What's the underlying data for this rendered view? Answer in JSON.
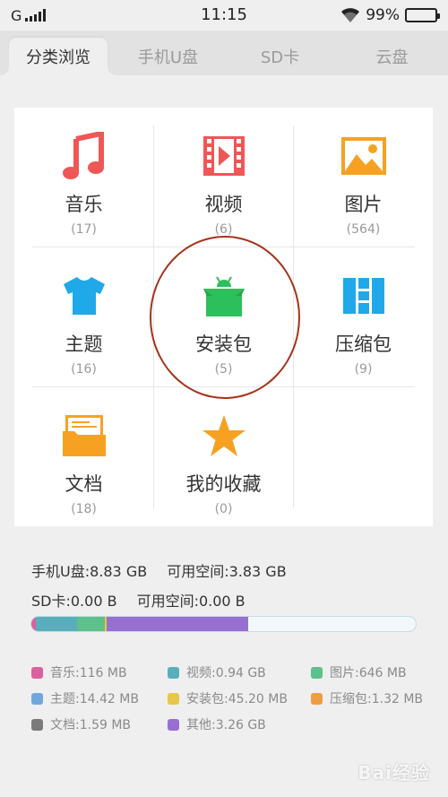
{
  "status_bar": {
    "network": "G",
    "time": "11:15",
    "battery": "99%"
  },
  "tabs": [
    {
      "label": "分类浏览",
      "active": true
    },
    {
      "label": "手机U盘",
      "active": false
    },
    {
      "label": "SD卡",
      "active": false
    },
    {
      "label": "云盘",
      "active": false
    }
  ],
  "categories": [
    {
      "label": "音乐",
      "count": "(17)",
      "icon": "music-note-icon",
      "color": "#ef5656"
    },
    {
      "label": "视频",
      "count": "(6)",
      "icon": "video-film-icon",
      "color": "#ef5656"
    },
    {
      "label": "图片",
      "count": "(564)",
      "icon": "image-icon",
      "color": "#f7a123"
    },
    {
      "label": "主题",
      "count": "(16)",
      "icon": "tshirt-icon",
      "color": "#1fa9e8"
    },
    {
      "label": "安装包",
      "count": "(5)",
      "icon": "android-package-icon",
      "color": "#2dbf5b"
    },
    {
      "label": "压缩包",
      "count": "(9)",
      "icon": "zip-archive-icon",
      "color": "#1fa9e8"
    },
    {
      "label": "文档",
      "count": "(18)",
      "icon": "folder-document-icon",
      "color": "#f7a123"
    },
    {
      "label": "我的收藏",
      "count": "(0)",
      "icon": "star-icon",
      "color": "#f7a123"
    }
  ],
  "storage": {
    "phone_label": "手机U盘:8.83 GB",
    "phone_free": "可用空间:3.83 GB",
    "sd_label": "SD卡:0.00 B",
    "sd_free": "可用空间:0.00 B"
  },
  "usage_segments": [
    {
      "name": "音乐",
      "color": "#d9619f",
      "fraction": 0.012
    },
    {
      "name": "视频",
      "color": "#5aaebc",
      "fraction": 0.106
    },
    {
      "name": "图片",
      "color": "#5ec08a",
      "fraction": 0.073
    },
    {
      "name": "安装包",
      "color": "#e8c64a",
      "fraction": 0.005
    },
    {
      "name": "其他",
      "color": "#9770cf",
      "fraction": 0.369
    }
  ],
  "legend": [
    {
      "text": "音乐:116 MB",
      "color": "#d9619f"
    },
    {
      "text": "视频:0.94 GB",
      "color": "#5aaebc"
    },
    {
      "text": "图片:646 MB",
      "color": "#5ec08a"
    },
    {
      "text": "主题:14.42 MB",
      "color": "#6fa7dc"
    },
    {
      "text": "安装包:45.20 MB",
      "color": "#e8c64a"
    },
    {
      "text": "压缩包:1.32 MB",
      "color": "#ef9c45"
    },
    {
      "text": "文档:1.59 MB",
      "color": "#7a7a7a"
    },
    {
      "text": "其他:3.26 GB",
      "color": "#9770cf"
    }
  ],
  "watermark": "Bai经验"
}
